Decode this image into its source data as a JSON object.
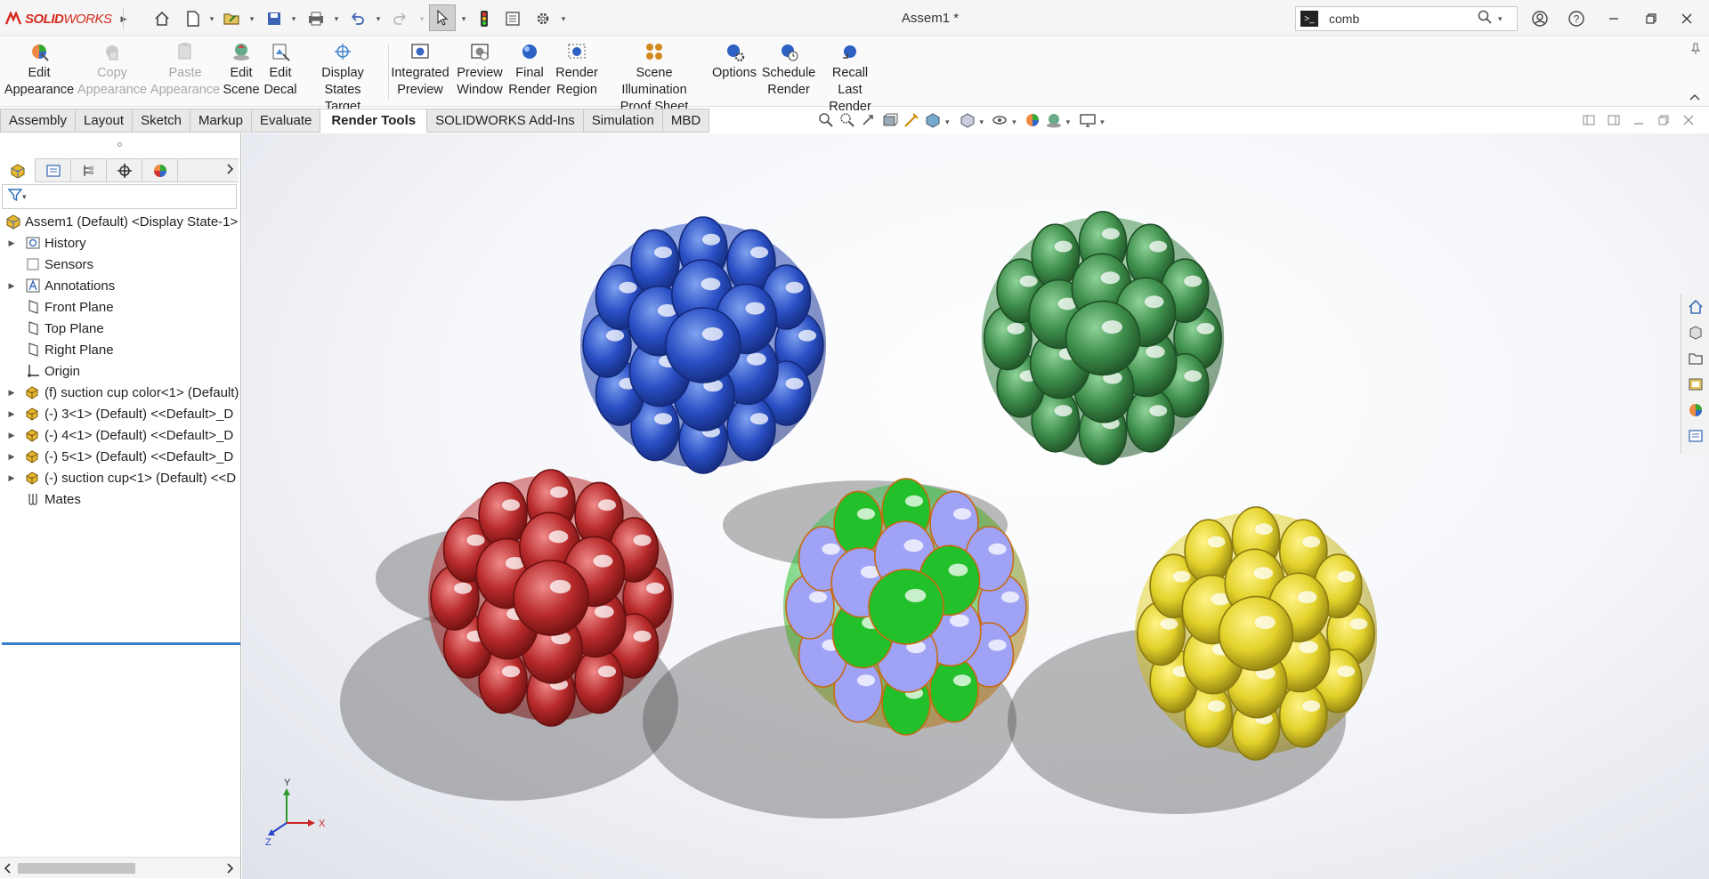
{
  "app": {
    "brand_bold": "SOLID",
    "brand_rest": "WORKS",
    "document_title": "Assem1 *"
  },
  "search": {
    "value": "comb"
  },
  "ribbon": {
    "buttons": [
      {
        "line1": "Edit",
        "line2": "Appearance",
        "enabled": true
      },
      {
        "line1": "Copy",
        "line2": "Appearance",
        "enabled": false
      },
      {
        "line1": "Paste",
        "line2": "Appearance",
        "enabled": false
      },
      {
        "line1": "Edit",
        "line2": "Scene",
        "enabled": true
      },
      {
        "line1": "Edit",
        "line2": "Decal",
        "enabled": true
      },
      {
        "line1": "Display States",
        "line2": "Target",
        "enabled": true
      },
      {
        "line1": "Integrated",
        "line2": "Preview",
        "enabled": true
      },
      {
        "line1": "Preview",
        "line2": "Window",
        "enabled": true
      },
      {
        "line1": "Final",
        "line2": "Render",
        "enabled": true
      },
      {
        "line1": "Render",
        "line2": "Region",
        "enabled": true
      },
      {
        "line1": "Scene Illumination",
        "line2": "Proof Sheet",
        "enabled": true
      },
      {
        "line1": "Options",
        "line2": "",
        "enabled": true
      },
      {
        "line1": "Schedule",
        "line2": "Render",
        "enabled": true
      },
      {
        "line1": "Recall Last",
        "line2": "Render",
        "enabled": true
      }
    ]
  },
  "tabs": [
    "Assembly",
    "Layout",
    "Sketch",
    "Markup",
    "Evaluate",
    "Render Tools",
    "SOLIDWORKS Add-Ins",
    "Simulation",
    "MBD"
  ],
  "active_tab": "Render Tools",
  "tree": {
    "root": "Assem1 (Default) <Display State-1>",
    "items": [
      {
        "label": "History",
        "icon": "history-icon",
        "expandable": true
      },
      {
        "label": "Sensors",
        "icon": "sensors-icon",
        "expandable": false
      },
      {
        "label": "Annotations",
        "icon": "annotations-icon",
        "expandable": true
      },
      {
        "label": "Front Plane",
        "icon": "plane-icon",
        "expandable": false
      },
      {
        "label": "Top Plane",
        "icon": "plane-icon",
        "expandable": false
      },
      {
        "label": "Right Plane",
        "icon": "plane-icon",
        "expandable": false
      },
      {
        "label": "Origin",
        "icon": "origin-icon",
        "expandable": false
      },
      {
        "label": "(f) suction cup color<1> (Default)",
        "icon": "part-icon",
        "expandable": true
      },
      {
        "label": "(-) 3<1> (Default) <<Default>_D",
        "icon": "part-icon",
        "expandable": true
      },
      {
        "label": "(-) 4<1> (Default) <<Default>_D",
        "icon": "part-icon",
        "expandable": true
      },
      {
        "label": "(-) 5<1> (Default) <<Default>_D",
        "icon": "part-icon",
        "expandable": true
      },
      {
        "label": "(-) suction cup<1> (Default) <<D",
        "icon": "part-icon",
        "expandable": true
      },
      {
        "label": "Mates",
        "icon": "mates-icon",
        "expandable": false
      }
    ]
  },
  "triad": {
    "y": "Y",
    "x": "X",
    "z": "Z"
  },
  "balls": [
    {
      "name": "blue-ball",
      "color": "#2a4fc4",
      "light": "#7fa1f0",
      "dark": "#13297a"
    },
    {
      "name": "green-ball",
      "color": "#3f8f4c",
      "light": "#8fd39a",
      "dark": "#1d4f25"
    },
    {
      "name": "red-ball",
      "color": "#b82a2a",
      "light": "#f08a8a",
      "dark": "#6a1010"
    },
    {
      "name": "multicolor-ball",
      "color": "#22c02a",
      "light": "#b6b8ff",
      "dark": "#c86a12"
    },
    {
      "name": "yellow-ball",
      "color": "#e3d22a",
      "light": "#fff48a",
      "dark": "#8a7a10"
    }
  ]
}
